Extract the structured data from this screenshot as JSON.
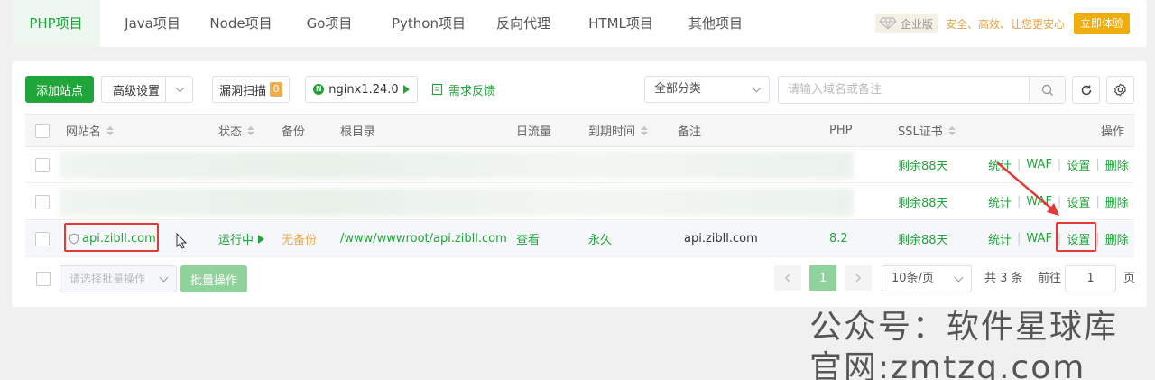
{
  "top_tabs": [
    "PHP项目",
    "Java项目",
    "Node项目",
    "Go项目",
    "Python项目",
    "反向代理",
    "HTML项目",
    "其他项目"
  ],
  "promo": {
    "edition": "企业版",
    "slogan": "安全、高效、让您更安心",
    "try_label": "立即体验"
  },
  "toolbar": {
    "add_site": "添加站点",
    "advanced": "高级设置",
    "vuln_scan": "漏洞扫描",
    "vuln_count": "0",
    "nginx": "nginx1.24.0",
    "feedback": "需求反馈",
    "category": "全部分类",
    "search_placeholder": "请输入域名或备注"
  },
  "table": {
    "headers": {
      "site_name": "网站名",
      "status": "状态",
      "backup": "备份",
      "root": "根目录",
      "traffic": "日流量",
      "expire": "到期时间",
      "note": "备注",
      "php": "PHP",
      "ssl": "SSL证书",
      "actions": "操作"
    },
    "rows": [
      {
        "ssl": "剩余88天"
      },
      {
        "ssl": "剩余88天"
      },
      {
        "site": "api.zibll.com",
        "status": "运行中",
        "backup": "无备份",
        "root": "/www/wwwroot/api.zibll.com",
        "traffic": "查看",
        "expire": "永久",
        "note": "api.zibll.com",
        "php": "8.2",
        "ssl": "剩余88天"
      }
    ],
    "action_labels": {
      "stats": "统计",
      "waf": "WAF",
      "settings": "设置",
      "delete": "删除"
    }
  },
  "footer": {
    "batch_placeholder": "请选择批量操作",
    "batch_button": "批量操作",
    "page": "1",
    "page_size": "10条/页",
    "total": "共 3 条",
    "goto_label": "前往",
    "goto_value": "1",
    "page_suffix": "页"
  },
  "watermark": {
    "line1": "公众号：软件星球库",
    "line2": "官网:zmtzq.com"
  },
  "colors": {
    "accent": "#20a53a",
    "highlight": "#e53935",
    "warning": "#f0ad4e"
  }
}
